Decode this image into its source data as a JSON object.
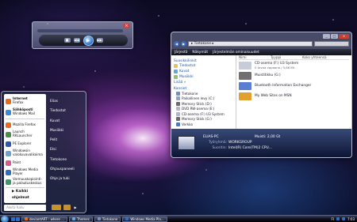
{
  "colors": {
    "accent": "#2a6fc4",
    "link": "#1a55a8",
    "close": "#c8402e",
    "shutdown": "#c8922a"
  },
  "mini_player": {
    "play_icon": "play-icon",
    "play_glyph": "▶",
    "prev_glyph": "◀◀",
    "next_glyph": "▶▶",
    "stop_glyph": "■",
    "close_glyph": "×"
  },
  "explorer": {
    "address": "▸ Tietokone ▸",
    "toolbar": [
      "Järjestä",
      "Näkymät",
      "Järjestelmän ominaisuudet"
    ],
    "window_buttons": {
      "minimize": "_",
      "maximize": "□",
      "close": "×"
    },
    "nav_back": "◀",
    "nav_forward": "▶",
    "favorites_header": "Suosikkilinkit",
    "favorites": [
      {
        "label": "Tiedostot",
        "color": "#e6c35a"
      },
      {
        "label": "Kuvat",
        "color": "#6aa3d8"
      },
      {
        "label": "Musiikki",
        "color": "#8fc56a"
      }
    ],
    "more_link": "Lisää »",
    "folders_header": "Kansiot",
    "tree": [
      {
        "label": "Tietokone",
        "color": "#7a8fb5"
      },
      {
        "label": "Paikallinen levy (C:)",
        "color": "#9aa2b5"
      },
      {
        "label": "Memory Stick (D:)",
        "color": "#6b6b6b"
      },
      {
        "label": "DVD RW-asema (E:)",
        "color": "#b5b5c5"
      },
      {
        "label": "CD-asema (F:) U3 System",
        "color": "#b5b5c5"
      },
      {
        "label": "Memory Stick (G:)",
        "color": "#6b6b6b"
      },
      {
        "label": "Verkko",
        "color": "#4c79c4"
      }
    ],
    "columns": [
      "Nimi",
      "Tyyppi",
      "Koko yhteensä"
    ],
    "items": [
      {
        "name": "CD-asema (F:) U3 System",
        "sub": "0 tavua vapaana / 5,66 Mt",
        "color": "#c8ccd8"
      },
      {
        "name": "Muistitikku (G:)",
        "sub": "",
        "color": "#707070"
      },
      {
        "name": "Bluetooth Information Exchanger",
        "sub": "",
        "color": "#5a7ed1"
      },
      {
        "name": "My Web Sites on MSN",
        "sub": "",
        "color": "#e0a030"
      }
    ],
    "details": {
      "computer_name": "ELIAS-PC",
      "memory_label": "Muisti:",
      "memory_value": "2,00 Gt",
      "workgroup_label": "Työryhmä:",
      "workgroup_value": "WORKGROUP",
      "cpu_label": "Suoritin:",
      "cpu_value": "Intel(R) Core(TM)2 CPU..."
    }
  },
  "start_menu": {
    "pinned": [
      {
        "label1": "Internet",
        "label2": "Firefox",
        "color": "#e86a1a"
      },
      {
        "label1": "Sähköposti",
        "label2": "Windows Mail",
        "color": "#3a8ad8"
      }
    ],
    "recent": [
      {
        "label": "Mozilla Firefox",
        "color": "#e86a1a"
      },
      {
        "label": "Launch RKLauncher",
        "color": "#4c8c4c"
      },
      {
        "label": "PE Explorer",
        "color": "#2a5ab0"
      },
      {
        "label": "Windowsin valokuvavalikoima",
        "color": "#6aa3d8"
      },
      {
        "label": "Paint",
        "color": "#d85a8a"
      },
      {
        "label": "Windows Media Player",
        "color": "#2a6fc4"
      },
      {
        "label": "Varmuuskopiointi- ja palautuskeskus",
        "color": "#3a9a6a"
      }
    ],
    "all_programs": "Kaikki ohjelmat",
    "all_arrow": "▶",
    "right_items": [
      "Elias",
      "Tiedostot",
      "Kuvat",
      "Musiikki",
      "Pelit",
      "Etsi",
      "Tietokone",
      "Ohjauspaneeli",
      "Ohje ja tuki"
    ],
    "search_placeholder": "Aloita haku",
    "power_arrow": "▶"
  },
  "taskbar": {
    "buttons": [
      {
        "label": "deviantART : where ...",
        "color": "#e86a1a"
      },
      {
        "label": "Themes",
        "color": "#6aa3d8"
      },
      {
        "label": "Tietokone",
        "color": "#7a8fb5"
      },
      {
        "label": "Windows Media Pla...",
        "color": "#2a6fc4"
      }
    ],
    "clock": "7:03",
    "tray_lang": "FI"
  }
}
